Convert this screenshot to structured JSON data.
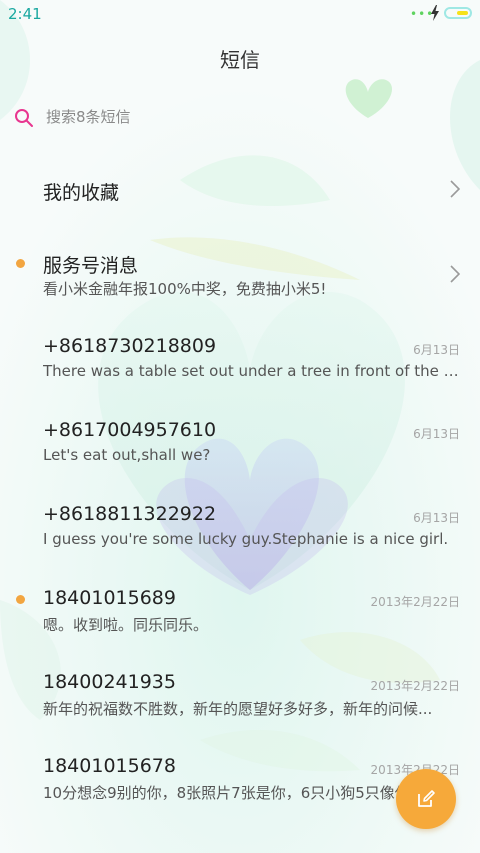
{
  "status_bar": {
    "time": "2:41"
  },
  "header": {
    "title": "短信"
  },
  "search": {
    "placeholder": "搜索8条短信"
  },
  "favorites": {
    "label": "我的收藏"
  },
  "service": {
    "title": "服务号消息",
    "preview": "看小米金融年报100%中奖，免费抽小米5!",
    "unread": true
  },
  "conversations": [
    {
      "sender": "+8618730218809",
      "date": "6月13日",
      "preview": "There was a table set out under a tree in front of the ho...",
      "unread": false
    },
    {
      "sender": "+8617004957610",
      "date": "6月13日",
      "preview": "Let's eat out,shall we?",
      "unread": false
    },
    {
      "sender": "+8618811322922",
      "date": "6月13日",
      "preview": "I guess you're some lucky guy.Stephanie is a nice girl.",
      "unread": false
    },
    {
      "sender": "18401015689",
      "date": "2013年2月22日",
      "preview": "嗯。收到啦。同乐同乐。",
      "unread": true
    },
    {
      "sender": "18400241935",
      "date": "2013年2月22日",
      "preview": "新年的祝福数不胜数，新年的愿望好多好多，新年的问候...",
      "unread": false
    },
    {
      "sender": "18401015678",
      "date": "2013年2月22日",
      "preview": "10分想念9别的你，8张照片7张是你，6只小狗5只像你",
      "unread": false
    }
  ],
  "icons": {
    "search": "search-icon",
    "chevron": "chevron-right-icon",
    "compose": "compose-icon",
    "battery": "battery-icon",
    "bolt": "charging-bolt-icon"
  },
  "colors": {
    "accent": "#f6a93a",
    "unread_dot": "#f2a540",
    "search_icon": "#e8368f",
    "status_time": "#1aa8a0"
  }
}
